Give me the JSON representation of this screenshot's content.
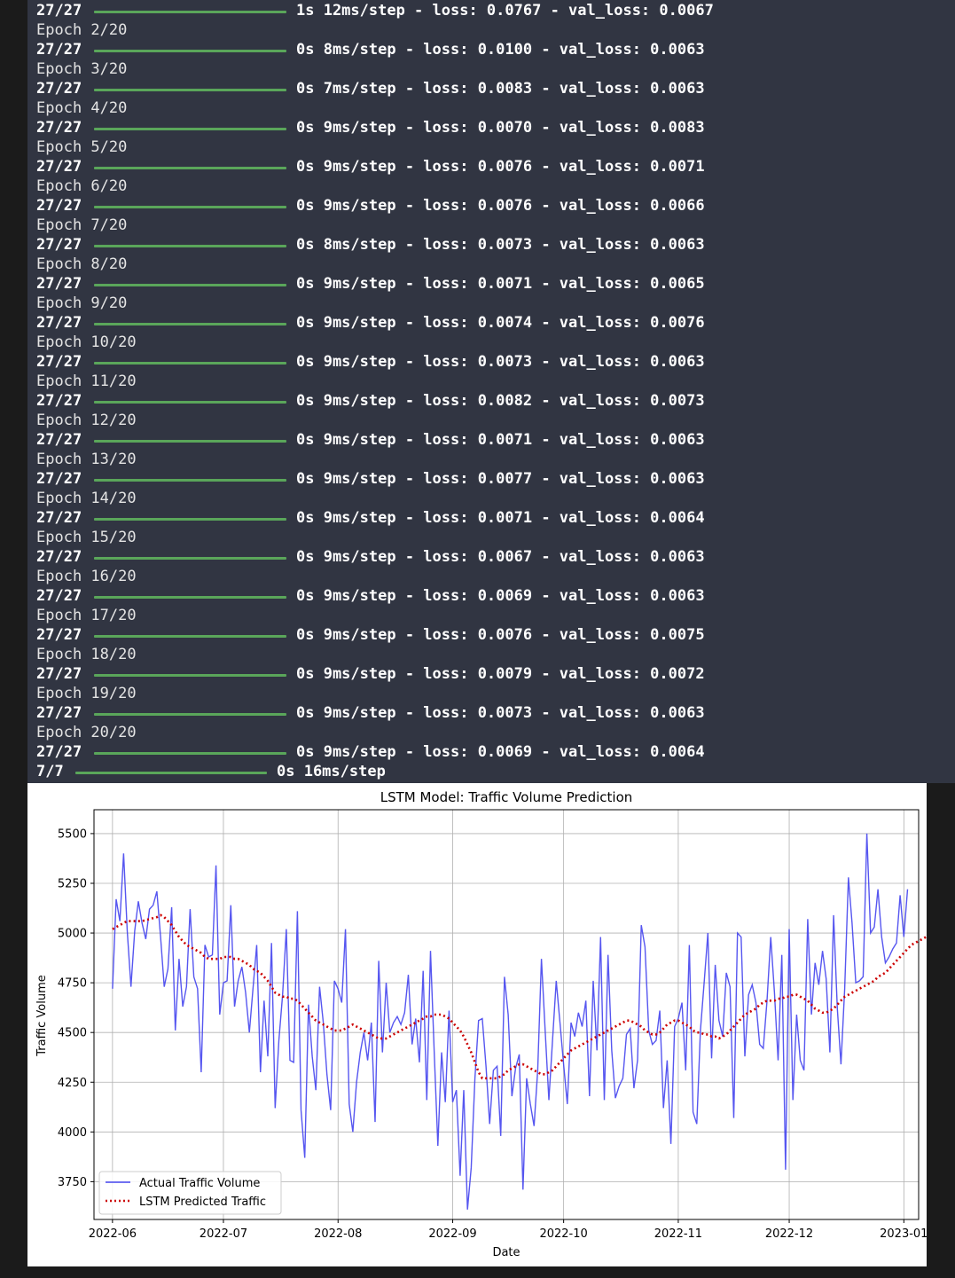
{
  "training_log": {
    "first_line": {
      "steps": "27/27",
      "stats": "1s 12ms/step - loss: 0.0767 - val_loss: 0.0067"
    },
    "epochs": [
      {
        "epoch": "Epoch 2/20",
        "steps": "27/27",
        "stats": "0s 8ms/step - loss: 0.0100 - val_loss: 0.0063"
      },
      {
        "epoch": "Epoch 3/20",
        "steps": "27/27",
        "stats": "0s 7ms/step - loss: 0.0083 - val_loss: 0.0063"
      },
      {
        "epoch": "Epoch 4/20",
        "steps": "27/27",
        "stats": "0s 9ms/step - loss: 0.0070 - val_loss: 0.0083"
      },
      {
        "epoch": "Epoch 5/20",
        "steps": "27/27",
        "stats": "0s 9ms/step - loss: 0.0076 - val_loss: 0.0071"
      },
      {
        "epoch": "Epoch 6/20",
        "steps": "27/27",
        "stats": "0s 9ms/step - loss: 0.0076 - val_loss: 0.0066"
      },
      {
        "epoch": "Epoch 7/20",
        "steps": "27/27",
        "stats": "0s 8ms/step - loss: 0.0073 - val_loss: 0.0063"
      },
      {
        "epoch": "Epoch 8/20",
        "steps": "27/27",
        "stats": "0s 9ms/step - loss: 0.0071 - val_loss: 0.0065"
      },
      {
        "epoch": "Epoch 9/20",
        "steps": "27/27",
        "stats": "0s 9ms/step - loss: 0.0074 - val_loss: 0.0076"
      },
      {
        "epoch": "Epoch 10/20",
        "steps": "27/27",
        "stats": "0s 9ms/step - loss: 0.0073 - val_loss: 0.0063"
      },
      {
        "epoch": "Epoch 11/20",
        "steps": "27/27",
        "stats": "0s 9ms/step - loss: 0.0082 - val_loss: 0.0073"
      },
      {
        "epoch": "Epoch 12/20",
        "steps": "27/27",
        "stats": "0s 9ms/step - loss: 0.0071 - val_loss: 0.0063"
      },
      {
        "epoch": "Epoch 13/20",
        "steps": "27/27",
        "stats": "0s 9ms/step - loss: 0.0077 - val_loss: 0.0063"
      },
      {
        "epoch": "Epoch 14/20",
        "steps": "27/27",
        "stats": "0s 9ms/step - loss: 0.0071 - val_loss: 0.0064"
      },
      {
        "epoch": "Epoch 15/20",
        "steps": "27/27",
        "stats": "0s 9ms/step - loss: 0.0067 - val_loss: 0.0063"
      },
      {
        "epoch": "Epoch 16/20",
        "steps": "27/27",
        "stats": "0s 9ms/step - loss: 0.0069 - val_loss: 0.0063"
      },
      {
        "epoch": "Epoch 17/20",
        "steps": "27/27",
        "stats": "0s 9ms/step - loss: 0.0076 - val_loss: 0.0075"
      },
      {
        "epoch": "Epoch 18/20",
        "steps": "27/27",
        "stats": "0s 9ms/step - loss: 0.0079 - val_loss: 0.0072"
      },
      {
        "epoch": "Epoch 19/20",
        "steps": "27/27",
        "stats": "0s 9ms/step - loss: 0.0073 - val_loss: 0.0063"
      },
      {
        "epoch": "Epoch 20/20",
        "steps": "27/27",
        "stats": "0s 9ms/step - loss: 0.0069 - val_loss: 0.0064"
      }
    ],
    "predict_line": {
      "steps": "7/7",
      "stats": "0s 16ms/step"
    },
    "progress_color": "#5aa65a",
    "background_color": "#313542"
  },
  "chart_data": {
    "type": "line",
    "title": "LSTM Model: Traffic Volume Prediction",
    "xlabel": "Date",
    "ylabel": "Traffic Volume",
    "x_ticks": [
      "2022-06",
      "2022-07",
      "2022-08",
      "2022-09",
      "2022-10",
      "2022-11",
      "2022-12",
      "2023-01"
    ],
    "y_ticks": [
      3750,
      4000,
      4250,
      4500,
      4750,
      5000,
      5250,
      5500
    ],
    "ylim": [
      3560,
      5620
    ],
    "xlim": [
      "2022-05-27",
      "2023-01-05"
    ],
    "grid": true,
    "legend_position": "lower-left",
    "start_date": "2022-06-01",
    "series": [
      {
        "name": "Actual Traffic Volume",
        "color": "#4444ee",
        "style": "solid",
        "values": [
          4720,
          5170,
          5060,
          5400,
          5010,
          4730,
          5010,
          5160,
          5050,
          4970,
          5120,
          5140,
          5210,
          4980,
          4730,
          4820,
          5130,
          4510,
          4870,
          4630,
          4730,
          5120,
          4780,
          4720,
          4300,
          4940,
          4880,
          4890,
          5340,
          4590,
          4750,
          4760,
          5140,
          4630,
          4760,
          4830,
          4700,
          4500,
          4720,
          4940,
          4300,
          4660,
          4380,
          4950,
          4120,
          4460,
          4690,
          5020,
          4360,
          4350,
          5110,
          4110,
          3870,
          4640,
          4380,
          4210,
          4730,
          4550,
          4290,
          4110,
          4760,
          4720,
          4650,
          5020,
          4140,
          4000,
          4250,
          4400,
          4500,
          4360,
          4550,
          4050,
          4860,
          4400,
          4750,
          4500,
          4550,
          4580,
          4540,
          4600,
          4790,
          4440,
          4570,
          4350,
          4810,
          4160,
          4910,
          4400,
          3930,
          4400,
          4150,
          4610,
          4150,
          4210,
          3780,
          4210,
          3610,
          3820,
          4270,
          4560,
          4570,
          4330,
          4040,
          4310,
          4330,
          3980,
          4780,
          4590,
          4180,
          4320,
          4390,
          3710,
          4270,
          4140,
          4030,
          4310,
          4870,
          4510,
          4160,
          4460,
          4760,
          4550,
          4340,
          4140,
          4550,
          4480,
          4600,
          4530,
          4660,
          4180,
          4760,
          4410,
          4980,
          4160,
          4890,
          4410,
          4170,
          4230,
          4270,
          4490,
          4520,
          4220,
          4360,
          5040,
          4930,
          4510,
          4440,
          4460,
          4610,
          4120,
          4360,
          3940,
          4530,
          4570,
          4650,
          4310,
          4940,
          4100,
          4040,
          4510,
          4750,
          5000,
          4370,
          4840,
          4560,
          4480,
          4800,
          4730,
          4070,
          5000,
          4980,
          4380,
          4690,
          4740,
          4650,
          4440,
          4420,
          4660,
          4980,
          4700,
          4360,
          4890,
          3810,
          5020,
          4160,
          4590,
          4360,
          4310,
          5070,
          4590,
          4850,
          4740,
          4910,
          4770,
          4400,
          5090,
          4620,
          4340,
          4720,
          5280,
          5050,
          4750,
          4760,
          4780,
          5500,
          5000,
          5030,
          5220,
          4980,
          4850,
          4880,
          4920,
          4950,
          5190,
          4980,
          5220
        ]
      },
      {
        "name": "LSTM Predicted Traffic",
        "color": "#cc0000",
        "style": "dotted",
        "values": [
          5020,
          5030,
          5040,
          5050,
          5060,
          5060,
          5060,
          5060,
          5060,
          5065,
          5070,
          5075,
          5080,
          5090,
          5080,
          5060,
          5040,
          5010,
          4980,
          4960,
          4940,
          4930,
          4920,
          4910,
          4900,
          4880,
          4870,
          4870,
          4870,
          4870,
          4880,
          4880,
          4880,
          4870,
          4870,
          4860,
          4850,
          4840,
          4820,
          4810,
          4800,
          4780,
          4760,
          4730,
          4700,
          4690,
          4680,
          4680,
          4670,
          4670,
          4660,
          4640,
          4620,
          4600,
          4580,
          4560,
          4550,
          4540,
          4530,
          4520,
          4510,
          4510,
          4510,
          4520,
          4530,
          4540,
          4530,
          4520,
          4510,
          4500,
          4490,
          4480,
          4470,
          4470,
          4470,
          4480,
          4490,
          4500,
          4510,
          4520,
          4530,
          4540,
          4550,
          4560,
          4570,
          4580,
          4580,
          4590,
          4590,
          4590,
          4580,
          4570,
          4550,
          4530,
          4510,
          4480,
          4440,
          4400,
          4350,
          4300,
          4270,
          4270,
          4270,
          4270,
          4270,
          4280,
          4290,
          4310,
          4320,
          4330,
          4340,
          4340,
          4330,
          4320,
          4310,
          4300,
          4290,
          4290,
          4300,
          4310,
          4330,
          4350,
          4370,
          4390,
          4410,
          4420,
          4430,
          4440,
          4450,
          4460,
          4470,
          4480,
          4490,
          4500,
          4510,
          4520,
          4530,
          4540,
          4550,
          4560,
          4560,
          4550,
          4540,
          4530,
          4510,
          4500,
          4490,
          4490,
          4500,
          4520,
          4540,
          4550,
          4560,
          4560,
          4550,
          4540,
          4530,
          4510,
          4500,
          4500,
          4490,
          4490,
          4480,
          4480,
          4470,
          4480,
          4490,
          4510,
          4530,
          4550,
          4570,
          4590,
          4600,
          4610,
          4620,
          4640,
          4650,
          4660,
          4660,
          4660,
          4670,
          4670,
          4680,
          4680,
          4690,
          4690,
          4680,
          4670,
          4660,
          4640,
          4620,
          4610,
          4600,
          4600,
          4610,
          4620,
          4640,
          4660,
          4680,
          4690,
          4700,
          4710,
          4720,
          4730,
          4740,
          4750,
          4760,
          4780,
          4790,
          4800,
          4820,
          4840,
          4860,
          4880,
          4900,
          4920,
          4940,
          4950,
          4960,
          4970,
          4980,
          4990,
          5000
        ]
      }
    ]
  }
}
